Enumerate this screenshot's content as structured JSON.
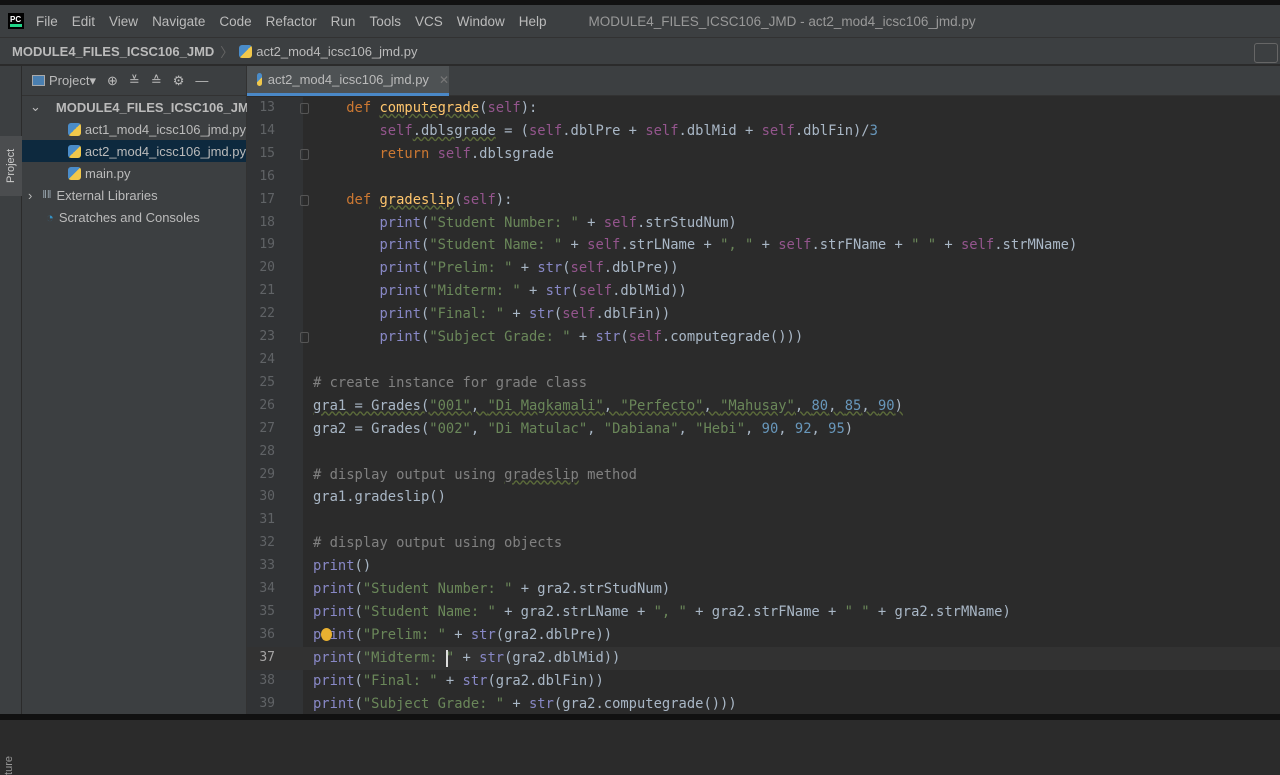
{
  "menubar": {
    "items": [
      "File",
      "Edit",
      "View",
      "Navigate",
      "Code",
      "Refactor",
      "Run",
      "Tools",
      "VCS",
      "Window",
      "Help"
    ],
    "title": "MODULE4_FILES_ICSC106_JMD - act2_mod4_icsc106_jmd.py"
  },
  "navbar": {
    "project": "MODULE4_FILES_ICSC106_JMD",
    "file": "act2_mod4_icsc106_jmd.py"
  },
  "stripe": {
    "project": "Project",
    "structure": "ture"
  },
  "panel": {
    "title": "Project",
    "tree": [
      {
        "label": "MODULE4_FILES_ICSC106_JMD",
        "type": "folder"
      },
      {
        "label": "act1_mod4_icsc106_jmd.py",
        "type": "py"
      },
      {
        "label": "act2_mod4_icsc106_jmd.py",
        "type": "py",
        "selected": true
      },
      {
        "label": "main.py",
        "type": "py"
      },
      {
        "label": "External Libraries",
        "type": "lib"
      },
      {
        "label": "Scratches and Consoles",
        "type": "scratch"
      }
    ]
  },
  "editor": {
    "tab": "act2_mod4_icsc106_jmd.py",
    "current_line": 37,
    "lines": [
      {
        "n": "13",
        "fold": true,
        "t": [
          [
            "",
            "    "
          ],
          [
            "kw",
            "def "
          ],
          [
            "fn wav",
            "computegrade"
          ],
          [
            "",
            "("
          ],
          [
            "self",
            "self"
          ],
          [
            "",
            "):"
          ]
        ]
      },
      {
        "n": "14",
        "t": [
          [
            "",
            "        "
          ],
          [
            "self",
            "self"
          ],
          [
            "wav",
            ".dblsgrade"
          ],
          [
            "",
            " = ("
          ],
          [
            "self",
            "self"
          ],
          [
            "",
            ".dblPre + "
          ],
          [
            "self",
            "self"
          ],
          [
            "",
            ".dblMid + "
          ],
          [
            "self",
            "self"
          ],
          [
            "",
            ".dblFin)/"
          ],
          [
            "num",
            "3"
          ]
        ]
      },
      {
        "n": "15",
        "fold": true,
        "t": [
          [
            "",
            "        "
          ],
          [
            "kw",
            "return "
          ],
          [
            "self",
            "self"
          ],
          [
            "",
            ".dblsgrade"
          ]
        ]
      },
      {
        "n": "16",
        "t": []
      },
      {
        "n": "17",
        "fold": true,
        "t": [
          [
            "",
            "    "
          ],
          [
            "kw",
            "def "
          ],
          [
            "fn wav",
            "gradeslip"
          ],
          [
            "",
            "("
          ],
          [
            "self",
            "self"
          ],
          [
            "",
            "):"
          ]
        ]
      },
      {
        "n": "18",
        "t": [
          [
            "",
            "        "
          ],
          [
            "bi",
            "print"
          ],
          [
            "",
            "("
          ],
          [
            "str",
            "\"Student Number: \""
          ],
          [
            "",
            " + "
          ],
          [
            "self",
            "self"
          ],
          [
            "",
            ".strStudNum)"
          ]
        ]
      },
      {
        "n": "19",
        "t": [
          [
            "",
            "        "
          ],
          [
            "bi",
            "print"
          ],
          [
            "",
            "("
          ],
          [
            "str",
            "\"Student Name: \""
          ],
          [
            "",
            " + "
          ],
          [
            "self",
            "self"
          ],
          [
            "",
            ".strLName + "
          ],
          [
            "str",
            "\", \""
          ],
          [
            "",
            " + "
          ],
          [
            "self",
            "self"
          ],
          [
            "",
            ".strFName + "
          ],
          [
            "str",
            "\" \""
          ],
          [
            "",
            " + "
          ],
          [
            "self",
            "self"
          ],
          [
            "",
            ".strMName)"
          ]
        ]
      },
      {
        "n": "20",
        "t": [
          [
            "",
            "        "
          ],
          [
            "bi",
            "print"
          ],
          [
            "",
            "("
          ],
          [
            "str",
            "\"Prelim: \""
          ],
          [
            "",
            " + "
          ],
          [
            "bi",
            "str"
          ],
          [
            "",
            "("
          ],
          [
            "self",
            "self"
          ],
          [
            "",
            ".dblPre))"
          ]
        ]
      },
      {
        "n": "21",
        "t": [
          [
            "",
            "        "
          ],
          [
            "bi",
            "print"
          ],
          [
            "",
            "("
          ],
          [
            "str",
            "\"Midterm: \""
          ],
          [
            "",
            " + "
          ],
          [
            "bi",
            "str"
          ],
          [
            "",
            "("
          ],
          [
            "self",
            "self"
          ],
          [
            "",
            ".dblMid))"
          ]
        ]
      },
      {
        "n": "22",
        "t": [
          [
            "",
            "        "
          ],
          [
            "bi",
            "print"
          ],
          [
            "",
            "("
          ],
          [
            "str",
            "\"Final: \""
          ],
          [
            "",
            " + "
          ],
          [
            "bi",
            "str"
          ],
          [
            "",
            "("
          ],
          [
            "self",
            "self"
          ],
          [
            "",
            ".dblFin))"
          ]
        ]
      },
      {
        "n": "23",
        "fold": true,
        "t": [
          [
            "",
            "        "
          ],
          [
            "bi",
            "print"
          ],
          [
            "",
            "("
          ],
          [
            "str",
            "\"Subject Grade: \""
          ],
          [
            "",
            " + "
          ],
          [
            "bi",
            "str"
          ],
          [
            "",
            "("
          ],
          [
            "self",
            "self"
          ],
          [
            "",
            ".computegrade()))"
          ]
        ]
      },
      {
        "n": "24",
        "t": []
      },
      {
        "n": "25",
        "t": [
          [
            "cmt",
            "# create instance for grade class"
          ]
        ]
      },
      {
        "n": "26",
        "t": [
          [
            "wav",
            "gra1 = Grades("
          ],
          [
            "str wav",
            "\"001\""
          ],
          [
            "wav",
            ", "
          ],
          [
            "str wav",
            "\"Di Magkamali\""
          ],
          [
            "wav",
            ", "
          ],
          [
            "str wav",
            "\"Perfecto\""
          ],
          [
            "wav",
            ", "
          ],
          [
            "str wav",
            "\"Mahusay\""
          ],
          [
            "wav",
            ", "
          ],
          [
            "num wav",
            "80"
          ],
          [
            "wav",
            ", "
          ],
          [
            "num wav",
            "85"
          ],
          [
            "wav",
            ", "
          ],
          [
            "num wav",
            "90"
          ],
          [
            "wav",
            ")"
          ]
        ]
      },
      {
        "n": "27",
        "t": [
          [
            "",
            "gra2 = Grades("
          ],
          [
            "str",
            "\"002\""
          ],
          [
            "",
            ", "
          ],
          [
            "str",
            "\"Di Matulac\""
          ],
          [
            "",
            ", "
          ],
          [
            "str",
            "\"Dabiana\""
          ],
          [
            "",
            ", "
          ],
          [
            "str",
            "\"Hebi\""
          ],
          [
            "",
            ", "
          ],
          [
            "num",
            "90"
          ],
          [
            "",
            ", "
          ],
          [
            "num",
            "92"
          ],
          [
            "",
            ", "
          ],
          [
            "num",
            "95"
          ],
          [
            "",
            ")"
          ]
        ]
      },
      {
        "n": "28",
        "t": []
      },
      {
        "n": "29",
        "t": [
          [
            "cmt",
            "# display output using "
          ],
          [
            "cmt wav",
            "gradeslip"
          ],
          [
            "cmt",
            " method"
          ]
        ]
      },
      {
        "n": "30",
        "t": [
          [
            "",
            "gra1.gradeslip()"
          ]
        ]
      },
      {
        "n": "31",
        "t": []
      },
      {
        "n": "32",
        "t": [
          [
            "cmt",
            "# display output using objects"
          ]
        ]
      },
      {
        "n": "33",
        "t": [
          [
            "bi",
            "print"
          ],
          [
            "",
            "()"
          ]
        ]
      },
      {
        "n": "34",
        "t": [
          [
            "bi",
            "print"
          ],
          [
            "",
            "("
          ],
          [
            "str",
            "\"Student Number: \""
          ],
          [
            "",
            " + gra2.strStudNum)"
          ]
        ]
      },
      {
        "n": "35",
        "t": [
          [
            "bi",
            "print"
          ],
          [
            "",
            "("
          ],
          [
            "str",
            "\"Student Name: \""
          ],
          [
            "",
            " + gra2.strLName + "
          ],
          [
            "str",
            "\", \""
          ],
          [
            "",
            " + gra2.strFName + "
          ],
          [
            "str",
            "\" \""
          ],
          [
            "",
            " + gra2.strMName)"
          ]
        ]
      },
      {
        "n": "36",
        "bulb": true,
        "t": [
          [
            "bi",
            "print"
          ],
          [
            "",
            "("
          ],
          [
            "str",
            "\"Prelim: \""
          ],
          [
            "",
            " + "
          ],
          [
            "bi",
            "str"
          ],
          [
            "",
            "(gra2.dblPre))"
          ]
        ]
      },
      {
        "n": "37",
        "caret": true,
        "t": [
          [
            "bi",
            "print"
          ],
          [
            "",
            "("
          ],
          [
            "str",
            "\"Midterm: \""
          ],
          [
            "",
            " + "
          ],
          [
            "bi",
            "str"
          ],
          [
            "",
            "(gra2.dblMid))"
          ]
        ]
      },
      {
        "n": "38",
        "t": [
          [
            "bi",
            "print"
          ],
          [
            "",
            "("
          ],
          [
            "str",
            "\"Final: \""
          ],
          [
            "",
            " + "
          ],
          [
            "bi",
            "str"
          ],
          [
            "",
            "(gra2.dblFin))"
          ]
        ]
      },
      {
        "n": "39",
        "t": [
          [
            "bi",
            "print"
          ],
          [
            "",
            "("
          ],
          [
            "str",
            "\"Subject Grade: \""
          ],
          [
            "",
            " + "
          ],
          [
            "bi",
            "str"
          ],
          [
            "",
            "(gra2.computegrade()))"
          ]
        ]
      }
    ]
  }
}
